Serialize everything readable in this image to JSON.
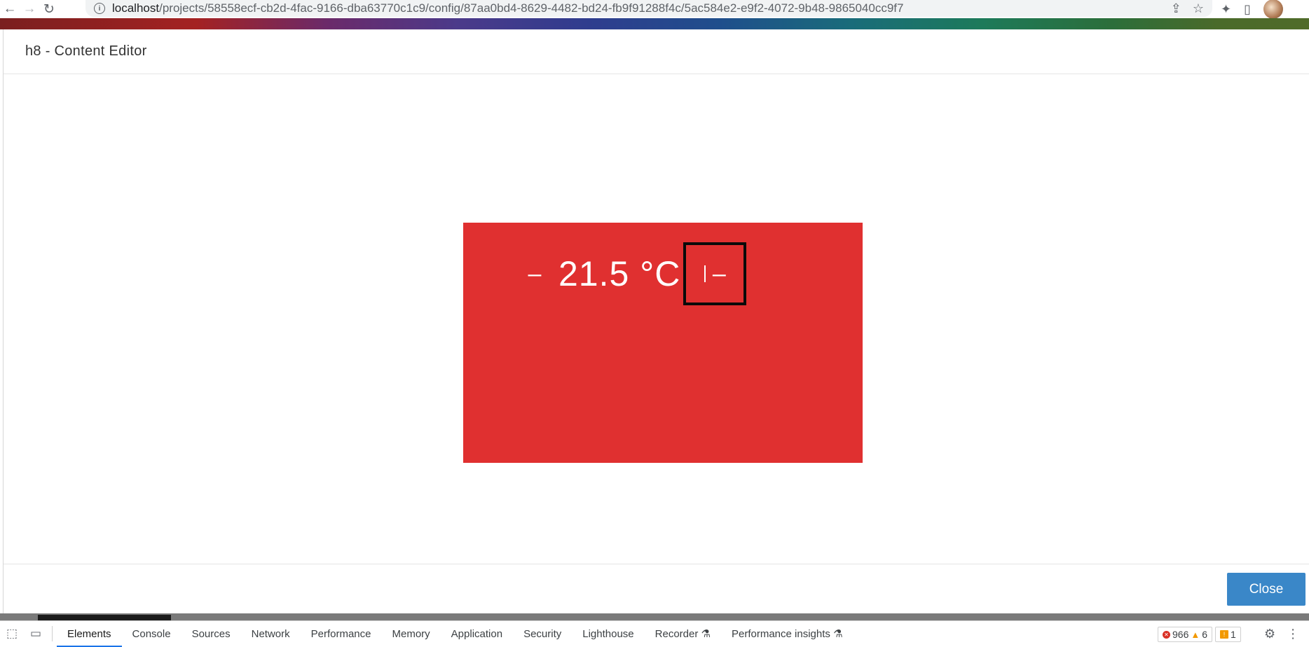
{
  "browser": {
    "url_host": "localhost",
    "url_path": "/projects/58558ecf-cb2d-4fac-9166-dba63770c1c9/config/87aa0bd4-8629-4482-bd24-fb9f91288f4c/5ac584e2-e9f2-4072-9b48-9865040cc9f7",
    "icons": {
      "back": "back-arrow-icon",
      "forward": "forward-arrow-icon",
      "reload": "reload-icon",
      "info": "info-icon",
      "share": "share-icon",
      "bookmark": "star-icon",
      "extensions": "puzzle-icon",
      "sidepanel": "side-panel-icon"
    }
  },
  "modal": {
    "title": "h8 - Content Editor",
    "widget": {
      "background": "#e03030",
      "minus_left": "–",
      "temperature": "21.5 °C",
      "minus_right": "–"
    },
    "close_label": "Close"
  },
  "devtools": {
    "tabs": [
      "Elements",
      "Console",
      "Sources",
      "Network",
      "Performance",
      "Memory",
      "Application",
      "Security",
      "Lighthouse",
      "Recorder",
      "Performance insights"
    ],
    "active_tab": "Elements",
    "errors": "966",
    "warnings": "6",
    "issues": "1",
    "accent": "#1a73e8"
  }
}
